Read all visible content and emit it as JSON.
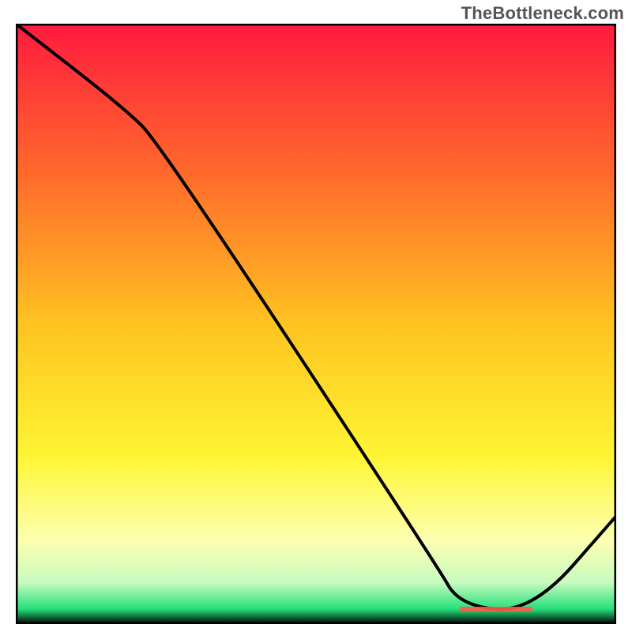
{
  "watermark": "TheBottleneck.com",
  "chart_data": {
    "type": "line",
    "title": "",
    "xlabel": "",
    "ylabel": "",
    "xlim": [
      0,
      100
    ],
    "ylim": [
      0,
      100
    ],
    "x": [
      0,
      18,
      24,
      70,
      74,
      86,
      100
    ],
    "y": [
      100,
      86,
      80,
      10,
      3,
      2,
      18
    ],
    "series": [
      {
        "name": "curve",
        "x": [
          0,
          18,
          24,
          70,
          74,
          86,
          100
        ],
        "y": [
          100,
          86,
          80,
          10,
          3,
          2,
          18
        ]
      }
    ],
    "hotspot": {
      "x_start": 74,
      "x_end": 86,
      "y": 0
    },
    "background_gradient_stops": [
      {
        "offset": 0.0,
        "color": "#ff1a3f"
      },
      {
        "offset": 0.25,
        "color": "#ff6a2b"
      },
      {
        "offset": 0.5,
        "color": "#ffc321"
      },
      {
        "offset": 0.72,
        "color": "#fff533"
      },
      {
        "offset": 0.86,
        "color": "#fdffb0"
      },
      {
        "offset": 0.93,
        "color": "#c9fbc0"
      },
      {
        "offset": 0.975,
        "color": "#25e07a"
      },
      {
        "offset": 1.0,
        "color": "#000000"
      }
    ]
  }
}
